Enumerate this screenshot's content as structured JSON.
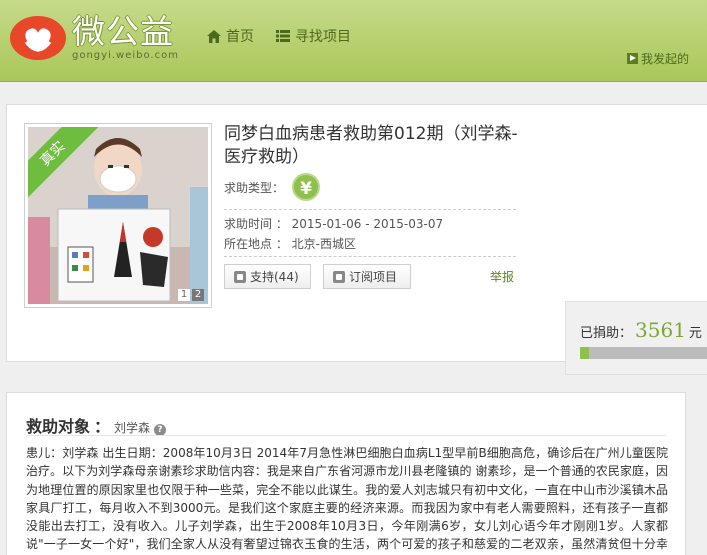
{
  "header": {
    "logo_text": "微公益",
    "logo_domain": "gongyi.weibo.com",
    "nav": [
      {
        "icon": "home-icon",
        "label": "首页"
      },
      {
        "icon": "list-icon",
        "label": "寻找项目"
      }
    ],
    "my_started": "我发起的"
  },
  "project": {
    "ribbon": "真实",
    "pager": [
      "1",
      "2"
    ],
    "title": "同梦白血病患者救助第012期（刘学森-医疗救助）",
    "type_label": "求助类型：",
    "type_icon": "¥",
    "time_label": "求助时间 ：",
    "time_value": "2015-01-06 - 2015-03-07",
    "location_label": "所在地点 ：",
    "location_value": "北京-西城区",
    "support_button": "支持(44)",
    "follow_button": "订阅项目",
    "report_link": "举报",
    "donated_label": "已捐助：",
    "donated_amount": "3561",
    "donated_unit": "元",
    "progress_fraction": 0.06
  },
  "target": {
    "title": "救助对象",
    "colon": "：",
    "name": "刘学森",
    "body": "患儿：刘学森 出生日期：2008年10月3日 2014年7月急性淋巴细胞白血病L1型早前B细胞高危，确诊后在广州儿童医院治疗。以下为刘学森母亲谢素珍求助信内容：我是来自广东省河源市龙川县老隆镇的 谢素珍，是一个普通的农民家庭，因为地理位置的原因家里也仅限于种一些菜，完全不能以此谋生。我的爱人刘志城只有初中文化，一直在中山市沙溪镇木品家具厂打工，每月收入不到3000元。是我们这个家庭主要的经济来源。而我因为家中有老人需要照料，还有孩子一直都没能出去打工，没有收入。儿子刘学森，出生于2008年10月3日，今年刚满6岁，女儿刘心语今年才刚刚1岁。人家都说\"一子一女一个好\"，我们全家人从没有奢望过锦衣玉食的生活，两个可爱的孩子和慈爱的二老双亲，虽然清贫但十分幸福。"
  },
  "colors": {
    "header_green": "#a9c75a",
    "accent_green": "#8fbf4c",
    "logo_red": "#e8472a"
  }
}
